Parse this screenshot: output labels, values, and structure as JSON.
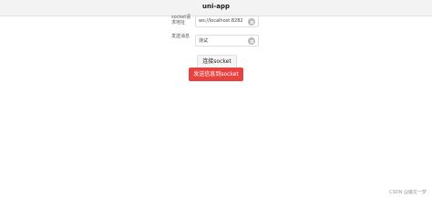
{
  "header": {
    "title": "uni-app"
  },
  "form": {
    "rows": [
      {
        "label": "socket请求地址",
        "value": "ws://localhost:8282"
      },
      {
        "label": "发送消息",
        "value": "测试"
      }
    ]
  },
  "buttons": {
    "connect": "连接socket",
    "send": "发送信息到socket"
  },
  "watermark": "CSDN @魔龙一梦",
  "colors": {
    "primary_warn": "#e64340",
    "topbar": "#f3f3f3"
  }
}
